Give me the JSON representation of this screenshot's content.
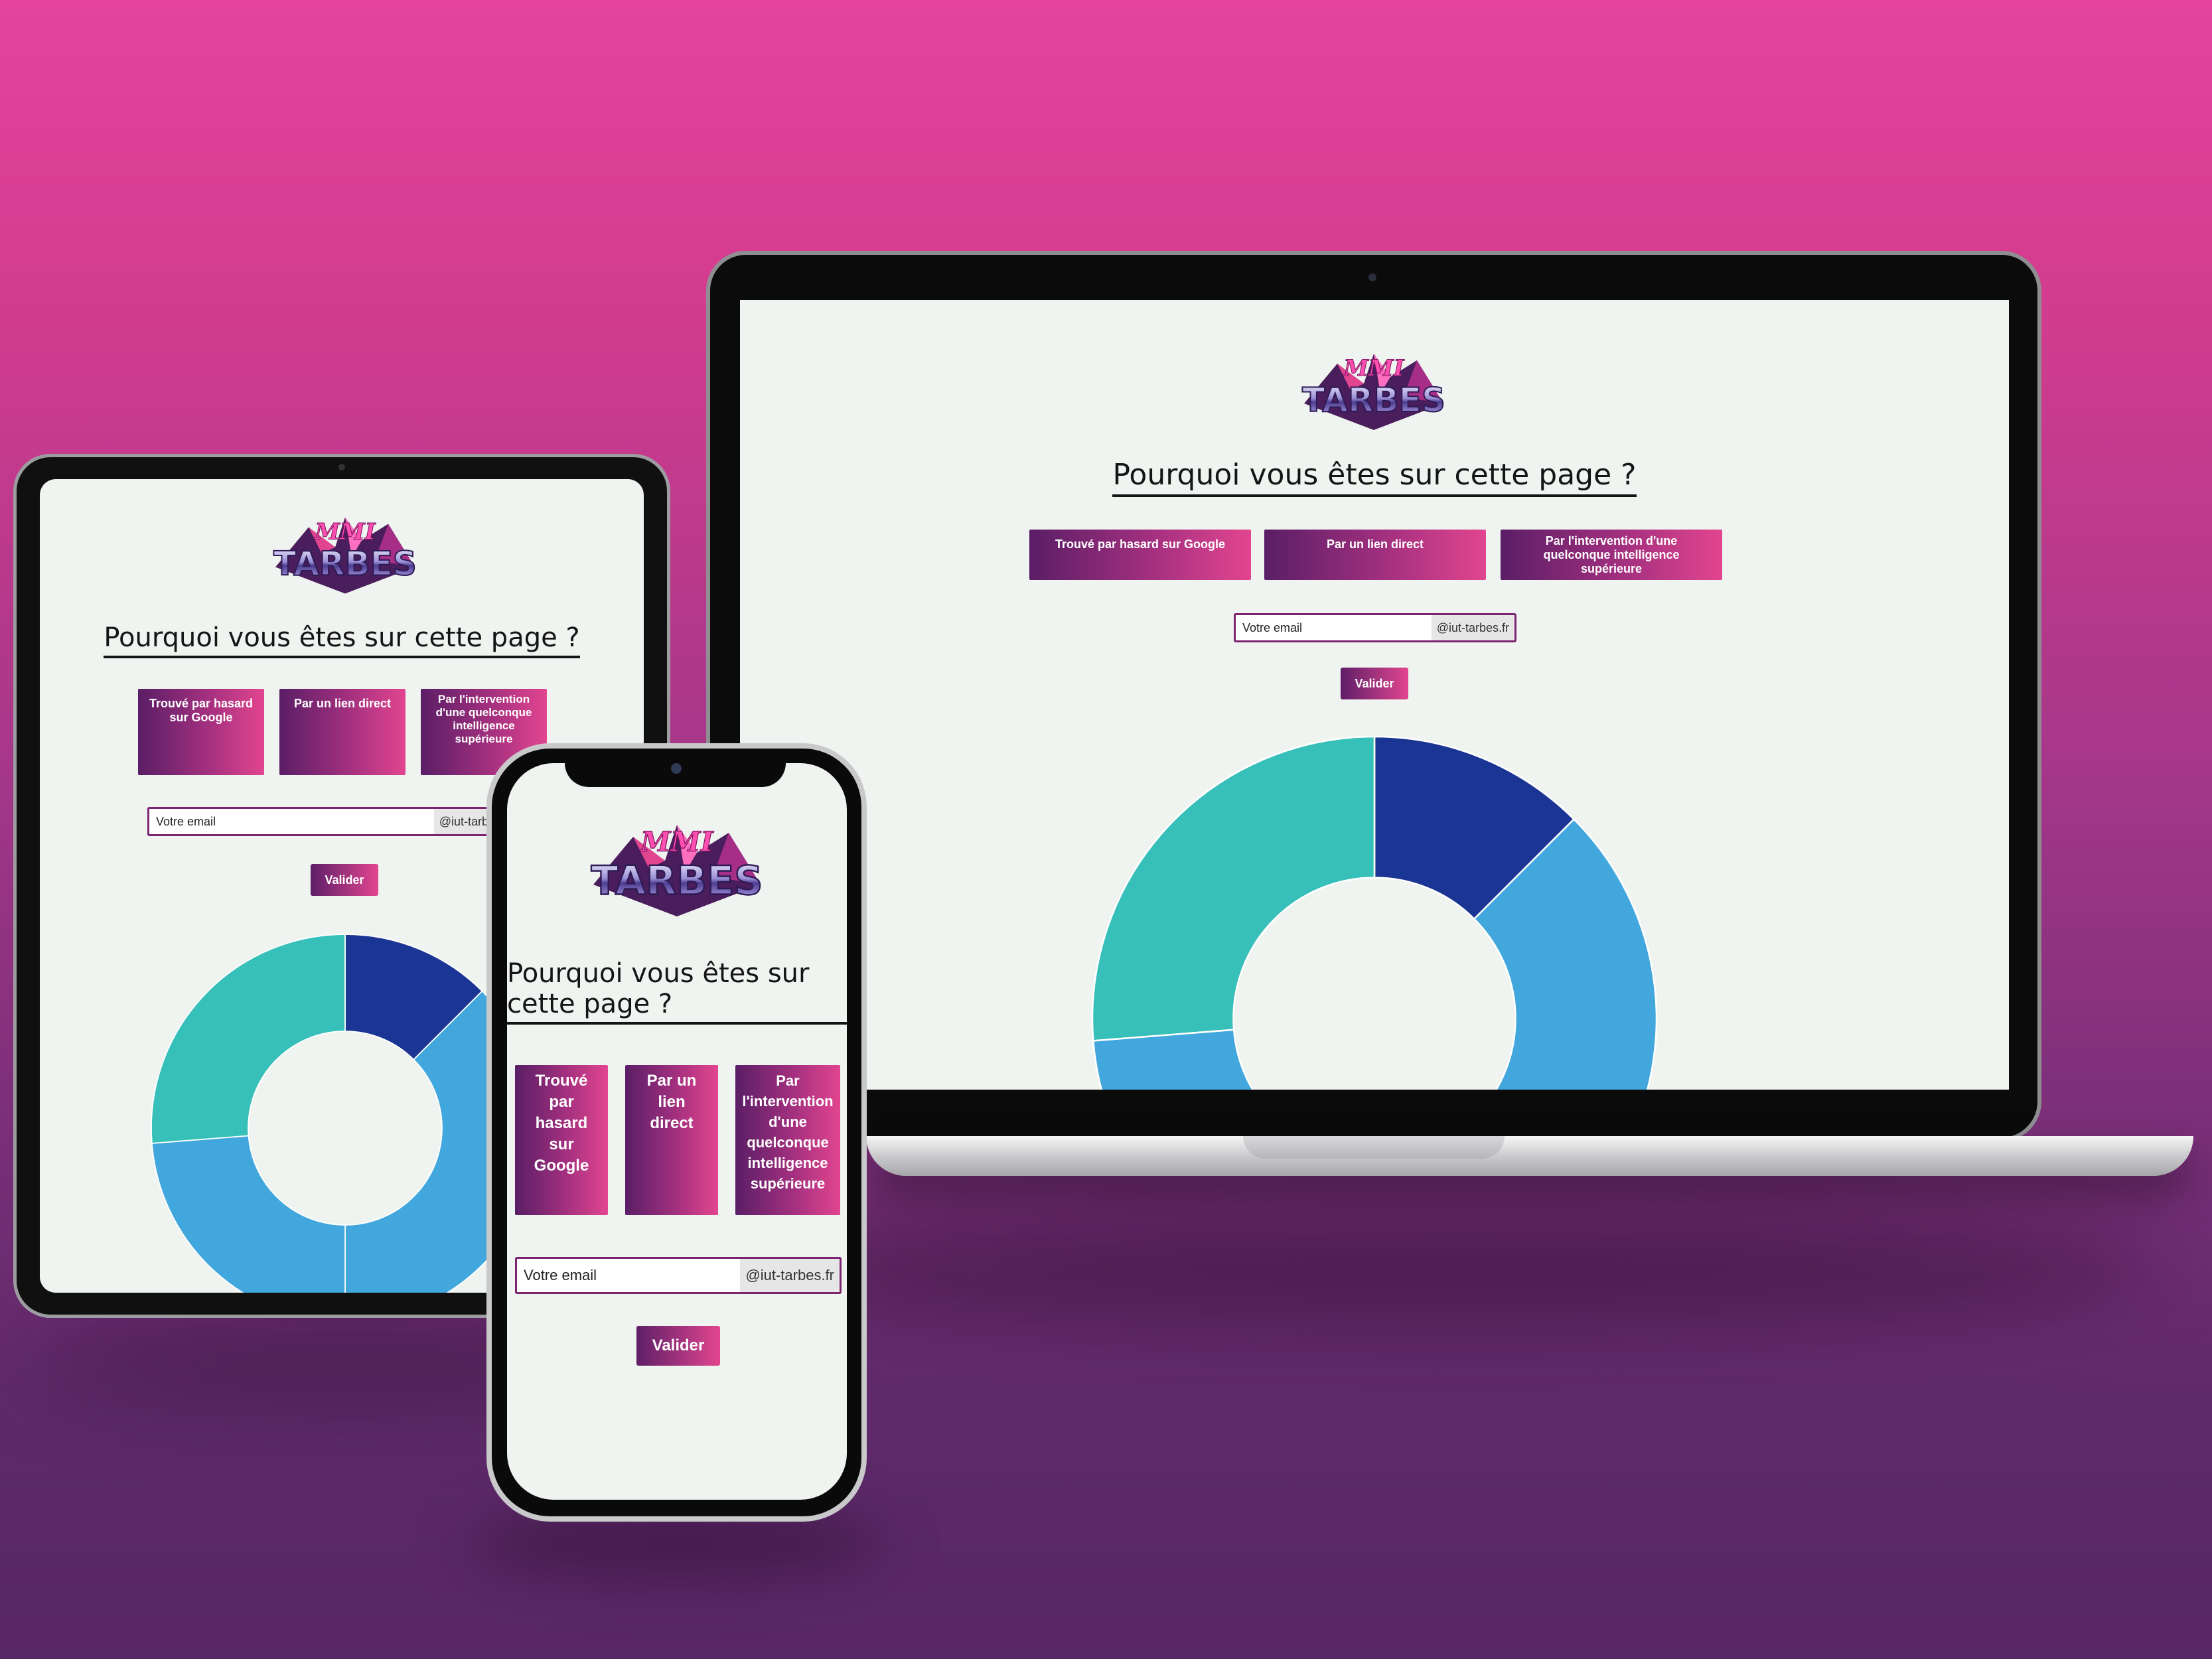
{
  "page": {
    "title": "Pourquoi vous êtes sur cette page ?",
    "logo": {
      "icon": "mmi-tarbes-logo",
      "text_top": "MMI",
      "text_bottom": "TARBES"
    },
    "choices": [
      "Trouvé par hasard sur Google",
      "Par un lien direct",
      "Par l'intervention d'une quelconque intelligence supérieure"
    ],
    "email": {
      "placeholder": "Votre email",
      "suffix": "@iut-tarbes.fr"
    },
    "validate_label": "Valider"
  },
  "chart_data": {
    "type": "pie",
    "style": "donut",
    "values": [
      10,
      30,
      19,
      21
    ],
    "colors": [
      "#1b3594",
      "#41a7dd",
      "#41a7dd",
      "#37c0b9"
    ],
    "labels": []
  },
  "theme": {
    "accent": "#e2458f",
    "accent_dark": "#5a1e66",
    "screen_bg": "#f0f4f0"
  }
}
